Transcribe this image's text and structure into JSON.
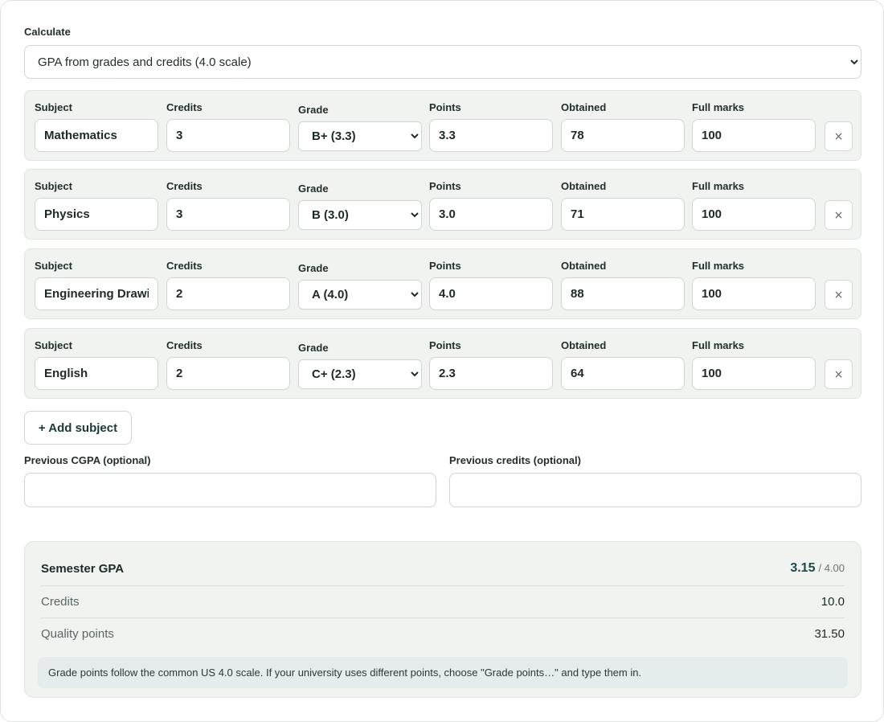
{
  "calculator": {
    "label": "Calculate",
    "mode": "GPA from grades and credits (4.0 scale)"
  },
  "field_labels": {
    "subject": "Subject",
    "credits": "Credits",
    "grade": "Grade",
    "points": "Points",
    "obtained": "Obtained",
    "full_marks": "Full marks"
  },
  "rows": [
    {
      "subject": "Mathematics",
      "credits": "3",
      "grade": "B+ (3.3)",
      "points": "3.3",
      "obtained": "78",
      "full_marks": "100"
    },
    {
      "subject": "Physics",
      "credits": "3",
      "grade": "B (3.0)",
      "points": "3.0",
      "obtained": "71",
      "full_marks": "100"
    },
    {
      "subject": "Engineering Drawing",
      "credits": "2",
      "grade": "A (4.0)",
      "points": "4.0",
      "obtained": "88",
      "full_marks": "100"
    },
    {
      "subject": "English",
      "credits": "2",
      "grade": "C+ (2.3)",
      "points": "2.3",
      "obtained": "64",
      "full_marks": "100"
    }
  ],
  "remove_symbol": "×",
  "add_subject_label": "+ Add subject",
  "previous": {
    "cgpa_label": "Previous CGPA (optional)",
    "cgpa_value": "",
    "credits_label": "Previous credits (optional)",
    "credits_value": ""
  },
  "results": {
    "title": "Semester GPA",
    "gpa": "3.15",
    "scale": "/ 4.00",
    "credits_label": "Credits",
    "credits_value": "10.0",
    "quality_label": "Quality points",
    "quality_value": "31.50",
    "note": "Grade points follow the common US 4.0 scale. If your university uses different points, choose \"Grade points…\" and type them in."
  },
  "colors": {
    "row_background": "#f1f3f1",
    "accent_text": "#1f4a47",
    "note_background": "#e5ecec"
  }
}
